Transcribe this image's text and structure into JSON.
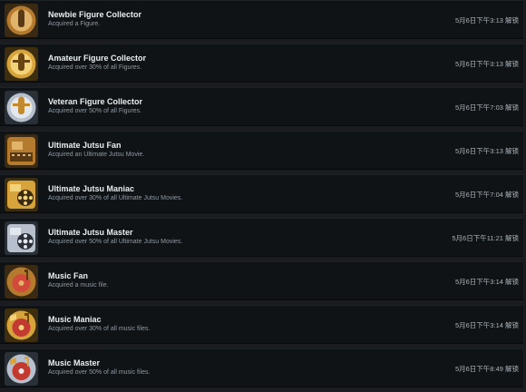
{
  "achievements": [
    {
      "title": "Newbie Figure Collector",
      "description": "Acquired a Figure.",
      "unlocked": "5月6日下午3:13 解锁",
      "icon": "figure-bronze-icon"
    },
    {
      "title": "Amateur Figure Collector",
      "description": "Acquired over 30% of all Figures.",
      "unlocked": "5月6日下午3:13 解锁",
      "icon": "figure-gold-icon"
    },
    {
      "title": "Veteran Figure Collector",
      "description": "Acquired over 50% of all Figures.",
      "unlocked": "5月6日下午7:03 解锁",
      "icon": "figure-silver-icon"
    },
    {
      "title": "Ultimate Jutsu Fan",
      "description": "Acquired an Ultimate Jutsu Movie.",
      "unlocked": "5月6日下午3:13 解锁",
      "icon": "film-bronze-icon"
    },
    {
      "title": "Ultimate Jutsu Maniac",
      "description": "Acquired over 30% of all Ultimate Jutsu Movies.",
      "unlocked": "5月6日下午7:04 解锁",
      "icon": "film-gold-icon"
    },
    {
      "title": "Ultimate Jutsu Master",
      "description": "Acquired over 50% of all Ultimate Jutsu Movies.",
      "unlocked": "5月6日下午11:21 解锁",
      "icon": "film-silver-icon"
    },
    {
      "title": "Music Fan",
      "description": "Acquired a music file.",
      "unlocked": "5月6日下午3:14 解锁",
      "icon": "music-bronze-icon"
    },
    {
      "title": "Music Maniac",
      "description": "Acquired over 30% of all music files.",
      "unlocked": "5月6日下午3:14 解锁",
      "icon": "music-gold-icon"
    },
    {
      "title": "Music Master",
      "description": "Acquired over 50% of all music files.",
      "unlocked": "5月6日下午8:49 解锁",
      "icon": "music-silver-icon"
    }
  ],
  "colors": {
    "bronze": "#b47a2e",
    "gold": "#d6a43a",
    "silver": "#b7c0cc",
    "row_background": "#0f1316"
  }
}
